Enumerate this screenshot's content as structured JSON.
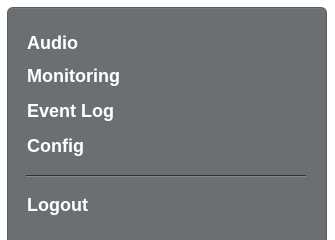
{
  "menu": {
    "items": [
      {
        "label": "Audio"
      },
      {
        "label": "Monitoring"
      },
      {
        "label": "Event Log"
      },
      {
        "label": "Config"
      }
    ],
    "logout_label": "Logout"
  },
  "colors": {
    "panel_background": "#6b6f72",
    "text": "#ffffff",
    "divider": "#2e3133"
  }
}
